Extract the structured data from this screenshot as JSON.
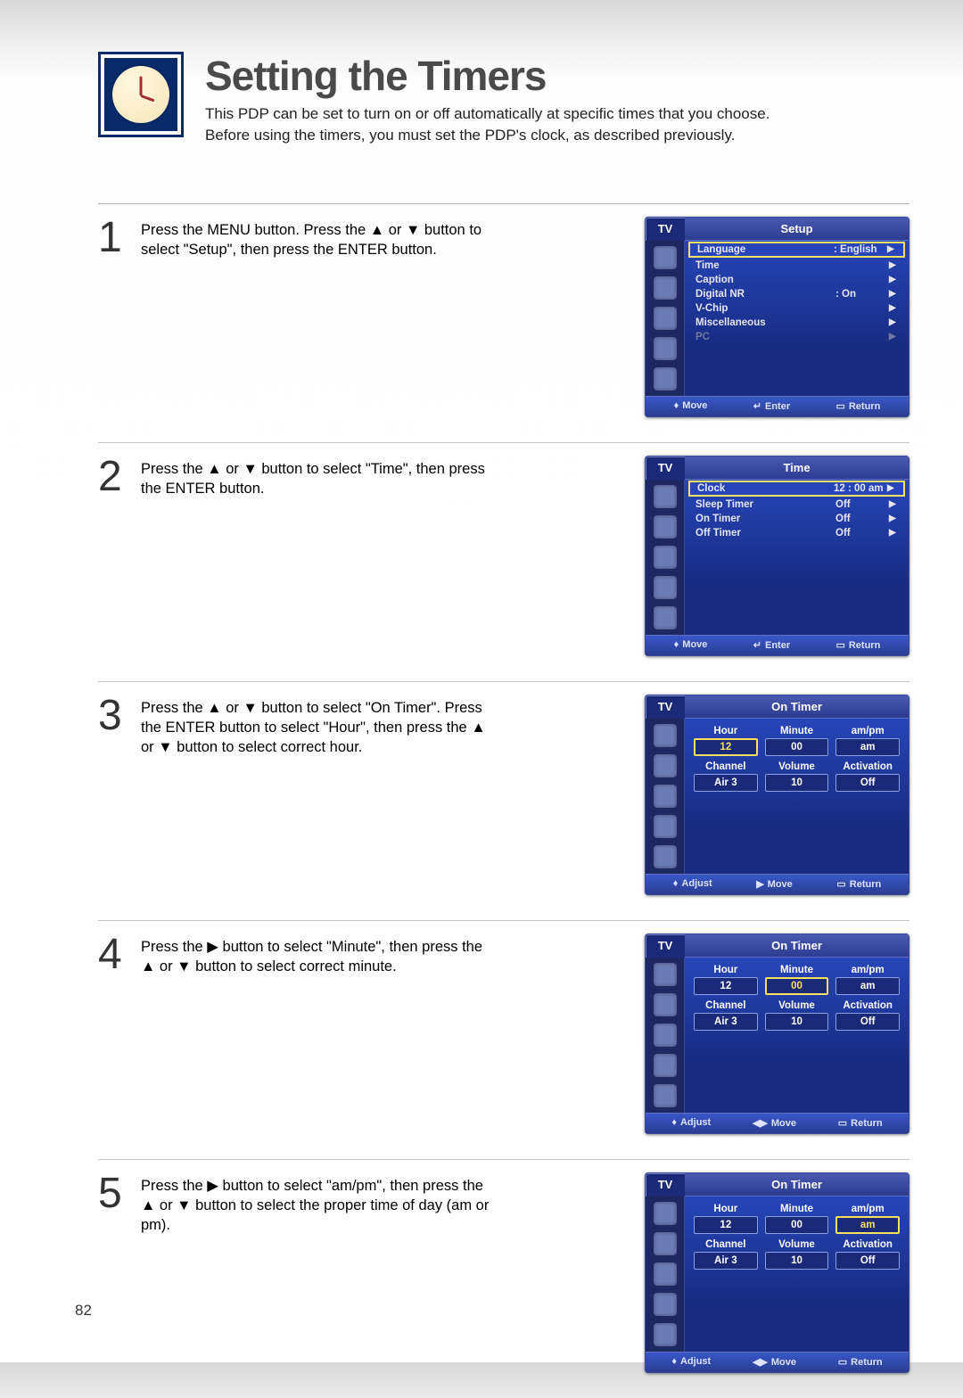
{
  "page_number": "82",
  "header": {
    "title": "Setting the Timers",
    "desc_line1": "This PDP can be set to turn on or off automatically at specific times that you choose.",
    "desc_line2": "Before using the timers, you must set the PDP's clock, as described previously."
  },
  "steps": [
    {
      "num": "1",
      "text": "Press the MENU button. Press the ▲ or ▼ button to select \"Setup\", then press the ENTER button."
    },
    {
      "num": "2",
      "text": "Press the ▲ or ▼ button to select \"Time\", then press the ENTER button."
    },
    {
      "num": "3",
      "text": "Press the ▲ or ▼ button to select \"On Timer\". Press the ENTER button to select \"Hour\", then press the ▲ or ▼ button to select correct hour."
    },
    {
      "num": "4",
      "text": "Press the ▶ button to select \"Minute\", then press the ▲ or ▼ button to select correct minute."
    },
    {
      "num": "5",
      "text": "Press the ▶ button to select \"am/pm\", then press the ▲ or ▼ button to select the proper time of day (am or pm)."
    }
  ],
  "osd": {
    "tv_label": "TV",
    "footer": {
      "move": "Move",
      "enter": "Enter",
      "ret": "Return",
      "adjust": "Adjust"
    },
    "setup": {
      "title": "Setup",
      "rows": [
        {
          "label": "Language",
          "value": ": English",
          "sel": true
        },
        {
          "label": "Time",
          "value": ""
        },
        {
          "label": "Caption",
          "value": ""
        },
        {
          "label": "Digital NR",
          "value": ": On"
        },
        {
          "label": "V-Chip",
          "value": ""
        },
        {
          "label": "Miscellaneous",
          "value": ""
        },
        {
          "label": "PC",
          "value": "",
          "dim": true
        }
      ]
    },
    "time": {
      "title": "Time",
      "rows": [
        {
          "label": "Clock",
          "value": "12 : 00 am",
          "sel": true
        },
        {
          "label": "Sleep Timer",
          "value": "Off"
        },
        {
          "label": "On Timer",
          "value": "Off"
        },
        {
          "label": "Off Timer",
          "value": "Off"
        }
      ]
    },
    "ontimer_header": "On Timer",
    "ontimer_labels": {
      "hour": "Hour",
      "minute": "Minute",
      "ampm": "am/pm",
      "channel": "Channel",
      "volume": "Volume",
      "activation": "Activation"
    },
    "ontimer_values": {
      "hour": "12",
      "minute": "00",
      "ampm": "am",
      "channel": "Air  3",
      "volume": "10",
      "activation": "Off"
    }
  }
}
